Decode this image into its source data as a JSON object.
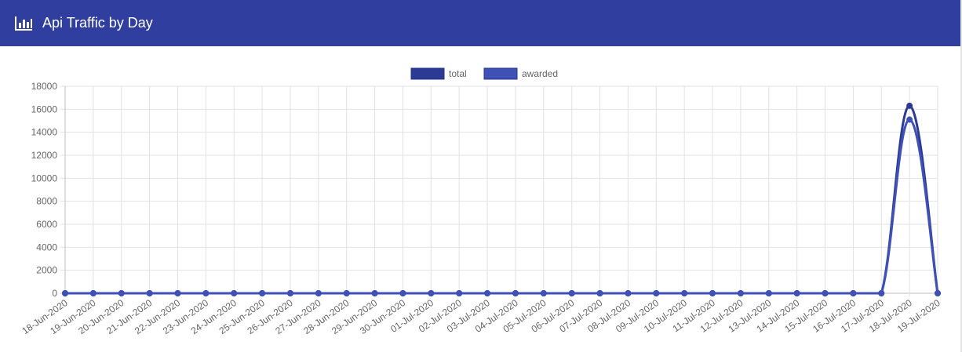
{
  "header": {
    "title": "Api Traffic by Day",
    "icon": "bar-chart-icon"
  },
  "chart_data": {
    "type": "line",
    "title": "",
    "xlabel": "",
    "ylabel": "",
    "ylim": [
      0,
      18000
    ],
    "yticks": [
      0,
      2000,
      4000,
      6000,
      8000,
      10000,
      12000,
      14000,
      16000,
      18000
    ],
    "grid": true,
    "legend_position": "top",
    "categories": [
      "18-Jun-2020",
      "19-Jun-2020",
      "20-Jun-2020",
      "21-Jun-2020",
      "22-Jun-2020",
      "23-Jun-2020",
      "24-Jun-2020",
      "25-Jun-2020",
      "26-Jun-2020",
      "27-Jun-2020",
      "28-Jun-2020",
      "29-Jun-2020",
      "30-Jun-2020",
      "01-Jul-2020",
      "02-Jul-2020",
      "03-Jul-2020",
      "04-Jul-2020",
      "05-Jul-2020",
      "06-Jul-2020",
      "07-Jul-2020",
      "08-Jul-2020",
      "09-Jul-2020",
      "10-Jul-2020",
      "11-Jul-2020",
      "12-Jul-2020",
      "13-Jul-2020",
      "14-Jul-2020",
      "15-Jul-2020",
      "16-Jul-2020",
      "17-Jul-2020",
      "18-Jul-2020",
      "19-Jul-2020"
    ],
    "series": [
      {
        "name": "total",
        "color": "#2c3a94",
        "values": [
          0,
          0,
          0,
          0,
          0,
          0,
          0,
          0,
          0,
          0,
          0,
          0,
          0,
          0,
          0,
          0,
          0,
          0,
          0,
          0,
          0,
          0,
          0,
          0,
          0,
          0,
          0,
          0,
          0,
          0,
          16300,
          0
        ]
      },
      {
        "name": "awarded",
        "color": "#3f51b5",
        "values": [
          0,
          0,
          0,
          0,
          0,
          0,
          0,
          0,
          0,
          0,
          0,
          0,
          0,
          0,
          0,
          0,
          0,
          0,
          0,
          0,
          0,
          0,
          0,
          0,
          0,
          0,
          0,
          0,
          0,
          0,
          15100,
          0
        ]
      }
    ]
  }
}
